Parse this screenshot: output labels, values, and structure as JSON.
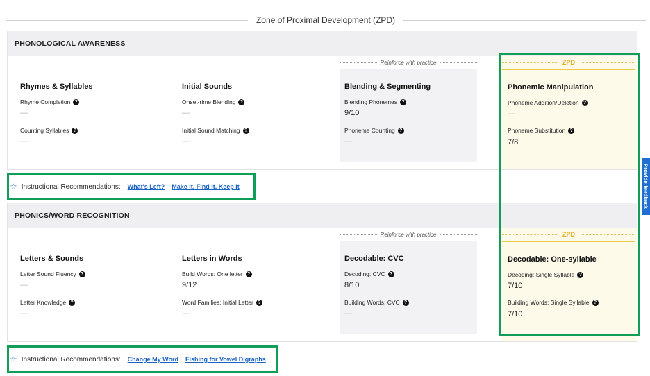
{
  "header": {
    "title": "Zone of Proximal Development (ZPD)"
  },
  "sections": [
    {
      "title": "PHONOLOGICAL AWARENESS",
      "reinforce_label": "Reinforce with practice",
      "zpd_label": "ZPD",
      "columns": [
        {
          "title": "Rhymes & Syllables",
          "skills": [
            {
              "name": "Rhyme Completion",
              "score": "—"
            },
            {
              "name": "Counting Syllables",
              "score": "—"
            }
          ]
        },
        {
          "title": "Initial Sounds",
          "skills": [
            {
              "name": "Onset-rime Blending",
              "score": "—"
            },
            {
              "name": "Initial Sound Matching",
              "score": "—"
            }
          ]
        },
        {
          "title": "Blending & Segmenting",
          "skills": [
            {
              "name": "Blending Phonemes",
              "score": "9/10"
            },
            {
              "name": "Phoneme Counting",
              "score": "—"
            }
          ]
        },
        {
          "title": "Phonemic Manipulation",
          "skills": [
            {
              "name": "Phoneme Addition/Deletion",
              "score": "—"
            },
            {
              "name": "Phoneme Substitution",
              "score": "7/8"
            }
          ]
        }
      ],
      "recommendations": {
        "label": "Instructional Recommendations:",
        "links": [
          "What's Left?",
          "Make It, Find It, Keep It"
        ]
      }
    },
    {
      "title": "PHONICS/WORD RECOGNITION",
      "reinforce_label": "Reinforce with practice",
      "zpd_label": "ZPD",
      "columns": [
        {
          "title": "Letters & Sounds",
          "skills": [
            {
              "name": "Letter Sound Fluency",
              "score": "—"
            },
            {
              "name": "Letter Knowledge",
              "score": "—"
            }
          ]
        },
        {
          "title": "Letters in Words",
          "skills": [
            {
              "name": "Build Words: One letter",
              "score": "9/12"
            },
            {
              "name": "Word Families: Initial Letter",
              "score": "—"
            }
          ]
        },
        {
          "title": "Decodable: CVC",
          "skills": [
            {
              "name": "Decoding: CVC",
              "score": "8/10"
            },
            {
              "name": "Building Words: CVC",
              "score": "—"
            }
          ]
        },
        {
          "title": "Decodable: One-syllable",
          "skills": [
            {
              "name": "Decoding: Single Syllable",
              "score": "7/10"
            },
            {
              "name": "Building Words: Single Syllable",
              "score": "7/10"
            }
          ]
        }
      ],
      "recommendations": {
        "label": "Instructional Recommendations:",
        "links": [
          "Change My Word",
          "Fishing for Vowel Digraphs"
        ]
      }
    }
  ],
  "feedback_tab": "Provide feedback",
  "colors": {
    "highlight": "#0f9d58",
    "zpd": "#e0ad1a",
    "link": "#1a62c4",
    "feedback": "#1f6fd1"
  },
  "icons": {
    "help": "question-circle-icon",
    "star": "star-outline-icon"
  }
}
